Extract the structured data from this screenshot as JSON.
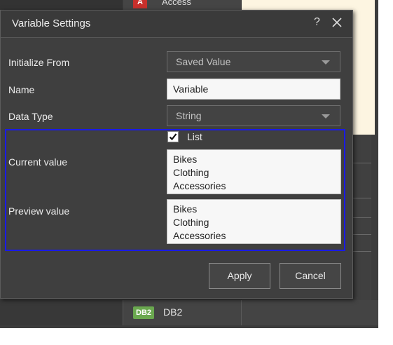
{
  "background": {
    "top_item_label": "Access",
    "top_item_icon": "access-app-icon",
    "bottom_item_badge": "DB2",
    "bottom_item_label": "DB2"
  },
  "dialog": {
    "title": "Variable Settings",
    "help_label": "?",
    "fields": {
      "initialize_from": {
        "label": "Initialize From",
        "value": "Saved Value"
      },
      "name": {
        "label": "Name",
        "value": "Variable"
      },
      "data_type": {
        "label": "Data Type",
        "value": "String"
      },
      "list": {
        "label": "List",
        "checked": true
      },
      "current_value": {
        "label": "Current value",
        "items": [
          "Bikes",
          "Clothing",
          "Accessories"
        ]
      },
      "preview_value": {
        "label": "Preview value",
        "items": [
          "Bikes",
          "Clothing",
          "Accessories"
        ]
      }
    },
    "buttons": {
      "apply": "Apply",
      "cancel": "Cancel"
    }
  },
  "colors": {
    "dialog_bg": "#3f3f3f",
    "highlight_border": "#1a1ae6",
    "input_bg": "#f7f7f7"
  }
}
